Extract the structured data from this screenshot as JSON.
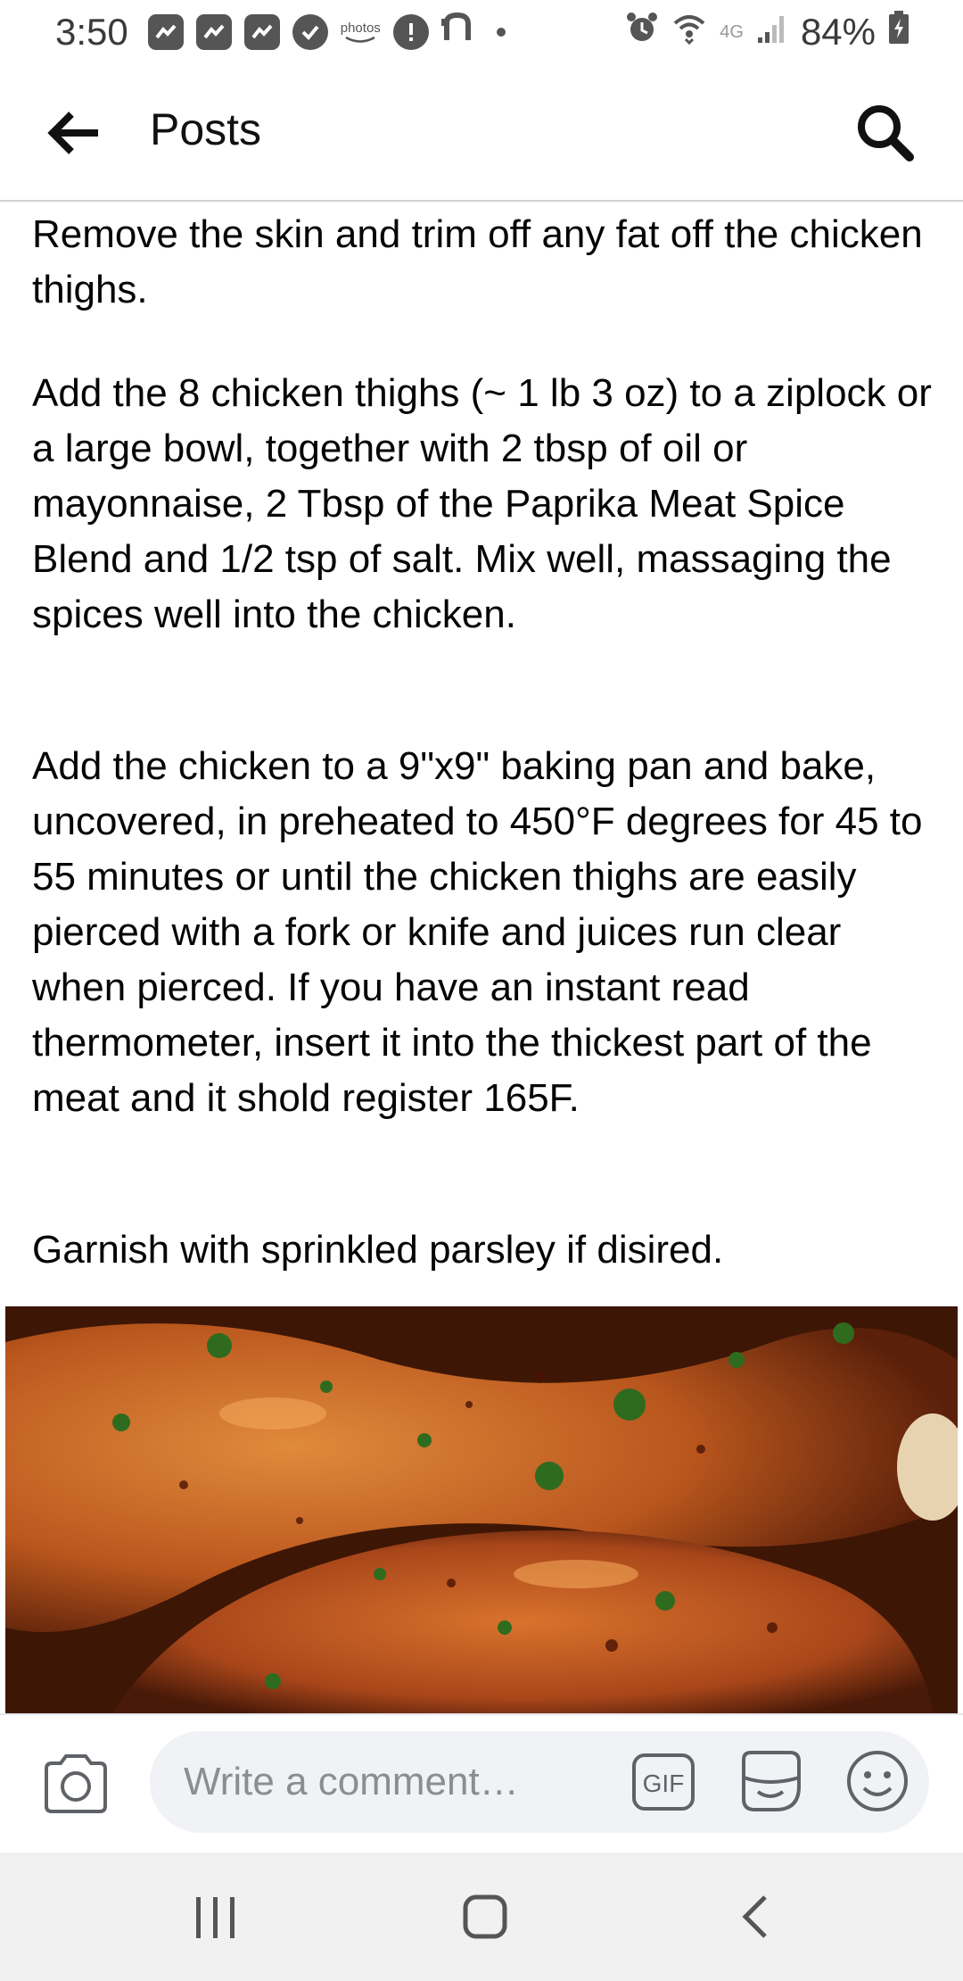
{
  "status_bar": {
    "time": "3:50",
    "photos_label": "photos",
    "network": "4G",
    "battery": "84%"
  },
  "header": {
    "title": "Posts"
  },
  "post": {
    "paragraphs": [
      "Remove the skin and trim off any fat off the chicken thighs.",
      "Add the 8 chicken thighs (~ 1 lb 3 oz) to a ziplock or a large bowl, together with 2 tbsp of oil or mayonnaise, 2 Tbsp of the Paprika Meat Spice Blend and 1/2 tsp of salt. Mix well, massaging the spices well into the chicken.",
      "Add the chicken to a 9\"x9\" baking pan and bake, uncovered, in preheated to 450°F degrees for 45 to 55 minutes or until the chicken thighs are easily pierced with a fork or knife and juices run clear when pierced. If you have an instant read thermometer, insert it into the thickest part of the meat and it shold register 165F.",
      "Garnish with sprinkled parsley if disired."
    ]
  },
  "comment_bar": {
    "placeholder": "Write a comment…",
    "gif_label": "GIF"
  },
  "icons": {
    "back": "arrow-left-icon",
    "search": "search-icon",
    "camera": "camera-icon",
    "gif": "gif-icon",
    "sticker": "sticker-icon",
    "emoji": "emoji-icon"
  },
  "colors": {
    "header_divider": "#cfd1d5",
    "comment_input_bg": "#f0f2f5",
    "placeholder_text": "#8a8d91",
    "nav_bar_bg": "#f1f1f1"
  }
}
